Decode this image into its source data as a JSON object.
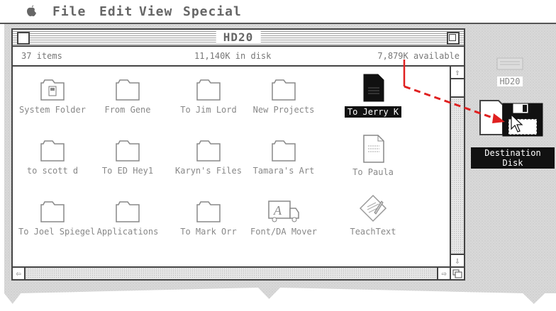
{
  "menubar": {
    "items": [
      "File",
      "Edit",
      "View",
      "Special"
    ]
  },
  "window": {
    "title": "HD20",
    "info": {
      "items": "37 items",
      "in_disk": "11,140K in disk",
      "available": "7,879K available"
    },
    "icons": [
      {
        "label": "System Folder",
        "type": "system-folder-icon"
      },
      {
        "label": "From Gene",
        "type": "folder-icon"
      },
      {
        "label": "To Jim Lord",
        "type": "folder-icon"
      },
      {
        "label": "New Projects",
        "type": "folder-icon"
      },
      {
        "label": "To Jerry K",
        "type": "document-icon",
        "selected": true
      },
      {
        "label": "to scott d",
        "type": "folder-icon"
      },
      {
        "label": "To ED Hey1",
        "type": "folder-icon"
      },
      {
        "label": "Karyn's Files",
        "type": "folder-icon"
      },
      {
        "label": "Tamara's Art",
        "type": "folder-icon"
      },
      {
        "label": "To Paula",
        "type": "document-icon"
      },
      {
        "label": "To Joel Spiegel",
        "type": "folder-icon"
      },
      {
        "label": "Applications",
        "type": "folder-icon"
      },
      {
        "label": "To Mark Orr",
        "type": "folder-icon"
      },
      {
        "label": "Font/DA Mover",
        "type": "font-da-mover-icon"
      },
      {
        "label": "TeachText",
        "type": "teachtext-icon"
      }
    ]
  },
  "desktop": {
    "hd20_label": "HD20",
    "destination_label": "Destination Disk"
  },
  "colors": {
    "annotation_arrow": "#e02020"
  }
}
